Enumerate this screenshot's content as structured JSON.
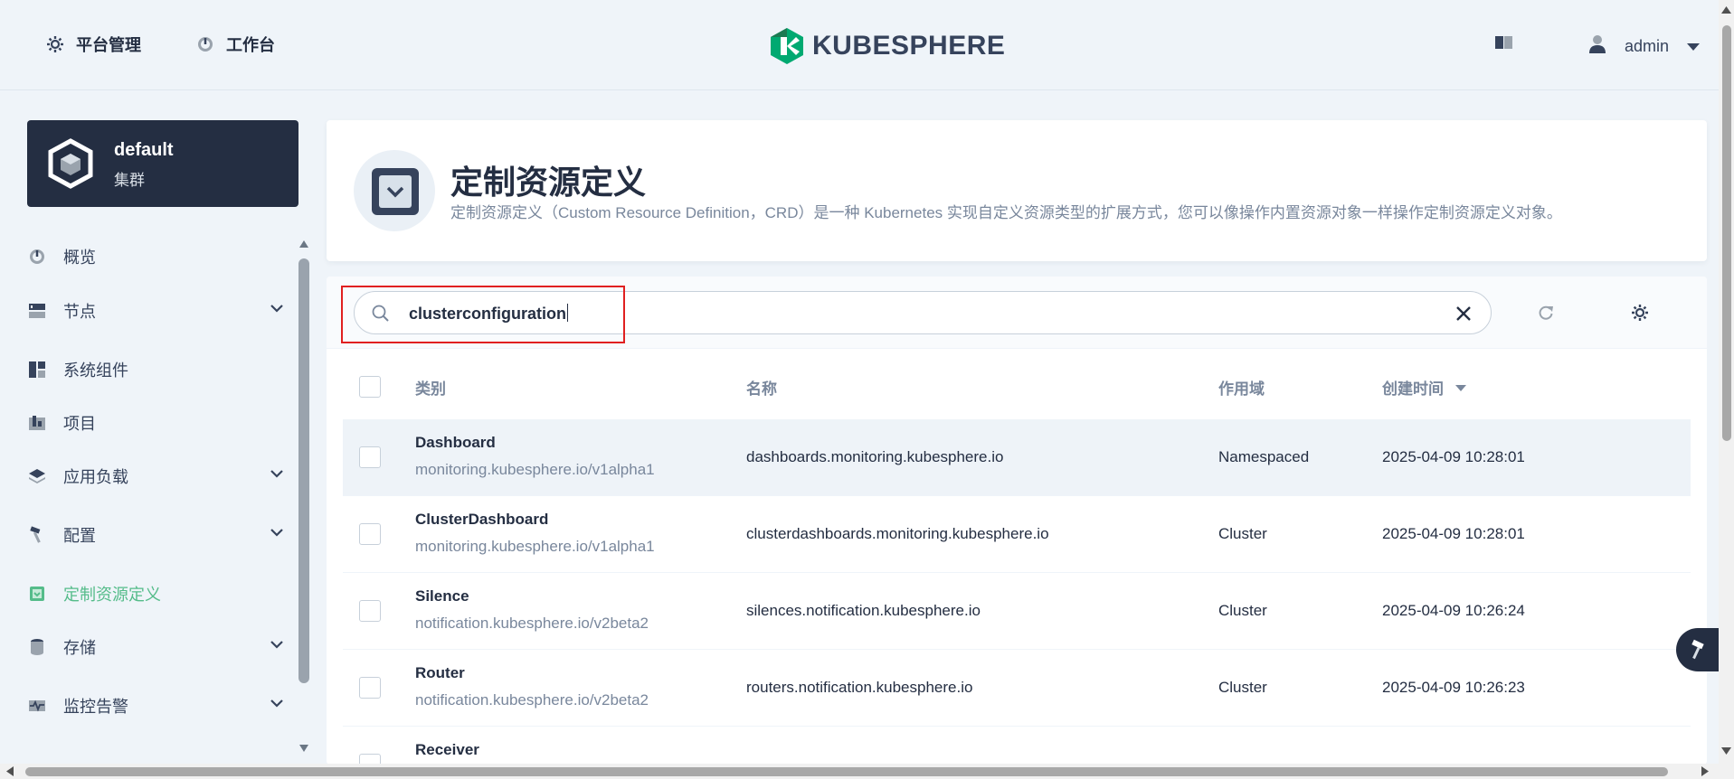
{
  "header": {
    "nav": [
      {
        "label": "平台管理",
        "icon": "gear-icon"
      },
      {
        "label": "工作台",
        "icon": "dashboard-icon"
      }
    ],
    "logo_text": "KUBESPHERE",
    "user": "admin"
  },
  "sidebar": {
    "cluster_name": "default",
    "cluster_sub": "集群",
    "items": [
      {
        "label": "概览",
        "icon": "dashboard-icon",
        "expandable": false
      },
      {
        "label": "节点",
        "icon": "nodes-icon",
        "expandable": true
      },
      {
        "label": "系统组件",
        "icon": "components-icon",
        "expandable": false
      },
      {
        "label": "项目",
        "icon": "project-icon",
        "expandable": false
      },
      {
        "label": "应用负载",
        "icon": "layers-icon",
        "expandable": true
      },
      {
        "label": "配置",
        "icon": "hammer-icon",
        "expandable": true
      },
      {
        "label": "定制资源定义",
        "icon": "crd-icon",
        "expandable": false,
        "active": true
      },
      {
        "label": "存储",
        "icon": "database-icon",
        "expandable": true
      },
      {
        "label": "监控告警",
        "icon": "monitor-icon",
        "expandable": true
      }
    ]
  },
  "banner": {
    "title": "定制资源定义",
    "description": "定制资源定义（Custom Resource Definition，CRD）是一种 Kubernetes 实现自定义资源类型的扩展方式，您可以像操作内置资源对象一样操作定制资源定义对象。"
  },
  "search": {
    "value": "clusterconfiguration"
  },
  "table": {
    "headers": {
      "kind": "类别",
      "name": "名称",
      "scope": "作用域",
      "created": "创建时间"
    },
    "rows": [
      {
        "kind": "Dashboard",
        "group": "monitoring.kubesphere.io/v1alpha1",
        "name": "dashboards.monitoring.kubesphere.io",
        "scope": "Namespaced",
        "created": "2025-04-09 10:28:01"
      },
      {
        "kind": "ClusterDashboard",
        "group": "monitoring.kubesphere.io/v1alpha1",
        "name": "clusterdashboards.monitoring.kubesphere.io",
        "scope": "Cluster",
        "created": "2025-04-09 10:28:01"
      },
      {
        "kind": "Silence",
        "group": "notification.kubesphere.io/v2beta2",
        "name": "silences.notification.kubesphere.io",
        "scope": "Cluster",
        "created": "2025-04-09 10:26:24"
      },
      {
        "kind": "Router",
        "group": "notification.kubesphere.io/v2beta2",
        "name": "routers.notification.kubesphere.io",
        "scope": "Cluster",
        "created": "2025-04-09 10:26:23"
      },
      {
        "kind": "Receiver",
        "group": "",
        "name": "",
        "scope": "",
        "created": ""
      }
    ]
  },
  "colors": {
    "accent": "#55bc8a",
    "dark": "#242e42",
    "highlight": "#e02020"
  }
}
